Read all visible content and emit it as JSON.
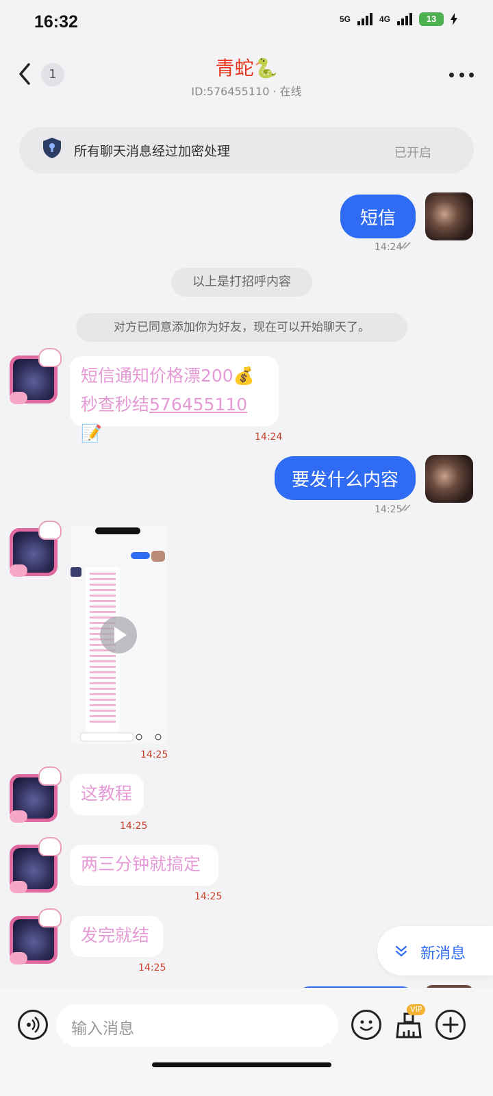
{
  "status_bar": {
    "time": "16:32",
    "net1": "5G",
    "net2": "4G",
    "battery": "13"
  },
  "header": {
    "title": "青蛇🐍",
    "subtitle": "ID:576455110 · 在线",
    "unread_badge": "1"
  },
  "encryption": {
    "text": "所有聊天消息经过加密处理",
    "status": "已开启"
  },
  "messages": {
    "m1": {
      "text": "短信",
      "time": "14:24"
    },
    "sys1": "以上是打招呼内容",
    "sys2": "对方已同意添加你为好友，现在可以开始聊天了。",
    "m2": {
      "line1": "短信通知价格漂200💰",
      "line2_prefix": "秒查秒结",
      "line2_link": "576455110",
      "line2_suffix": "📝",
      "time": "14:24"
    },
    "m3": {
      "text": "要发什么内容",
      "time": "14:25"
    },
    "m4": {
      "time": "14:25"
    },
    "m5": {
      "text": "这教程",
      "time": "14:25"
    },
    "m6": {
      "text": "两三分钟就搞定",
      "time": "14:25"
    },
    "m7": {
      "text": "发完就结",
      "time": "14:25"
    }
  },
  "new_message_label": "新消息",
  "input": {
    "placeholder": "输入消息",
    "vip_badge": "VIP"
  },
  "icons": [
    "back-icon",
    "more-icon",
    "shield-icon",
    "play-icon",
    "chevron-down-icon",
    "voice-icon",
    "emoji-icon",
    "broom-icon",
    "plus-icon"
  ]
}
